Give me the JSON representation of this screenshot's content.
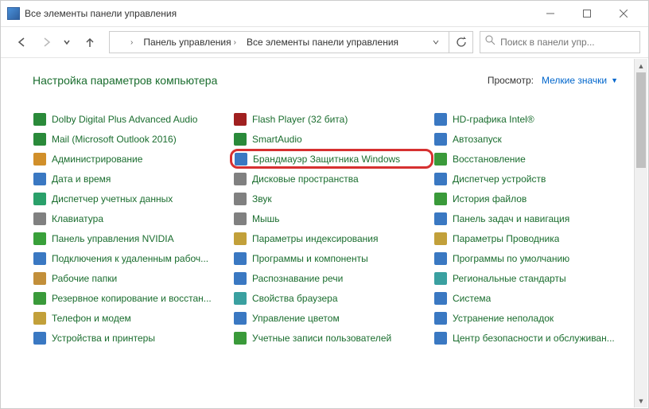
{
  "window": {
    "title": "Все элементы панели управления"
  },
  "toolbar": {
    "seg1": "Панель управления",
    "seg2": "Все элементы панели управления"
  },
  "search": {
    "placeholder": "Поиск в панели упр..."
  },
  "header": {
    "title": "Настройка параметров компьютера",
    "view_label": "Просмотр:",
    "view_value": "Мелкие значки"
  },
  "highlight_key": "c1r2",
  "col0": {
    "r0": "Dolby Digital Plus Advanced Audio",
    "r1": "Mail (Microsoft Outlook 2016)",
    "r2": "Администрирование",
    "r3": "Дата и время",
    "r4": "Диспетчер учетных данных",
    "r5": "Клавиатура",
    "r6": "Панель управления NVIDIA",
    "r7": "Подключения к удаленным рабоч...",
    "r8": "Рабочие папки",
    "r9": "Резервное копирование и восстан...",
    "r10": "Телефон и модем",
    "r11": "Устройства и принтеры"
  },
  "col1": {
    "r0": "Flash Player (32 бита)",
    "r1": "SmartAudio",
    "r2": "Брандмауэр Защитника Windows",
    "r3": "Дисковые пространства",
    "r4": "Звук",
    "r5": "Мышь",
    "r6": "Параметры индексирования",
    "r7": "Программы и компоненты",
    "r8": "Распознавание речи",
    "r9": "Свойства браузера",
    "r10": "Управление цветом",
    "r11": "Учетные записи пользователей"
  },
  "col2": {
    "r0": "HD-графика Intel®",
    "r1": "Автозапуск",
    "r2": "Восстановление",
    "r3": "Диспетчер устройств",
    "r4": "История файлов",
    "r5": "Панель задач и навигация",
    "r6": "Параметры Проводника",
    "r7": "Программы по умолчанию",
    "r8": "Региональные стандарты",
    "r9": "Система",
    "r10": "Устранение неполадок",
    "r11": "Центр безопасности и обслуживан..."
  },
  "icons": {
    "c0r0": "#2a8a3a",
    "c0r1": "#2a8a3a",
    "c0r2": "#d18f2a",
    "c0r3": "#3a78c2",
    "c0r4": "#2aa06a",
    "c0r5": "#808080",
    "c0r6": "#39a03a",
    "c0r7": "#3a78c2",
    "c0r8": "#c28f3a",
    "c0r9": "#3a9a3a",
    "c0r10": "#c2a03a",
    "c0r11": "#3a78c2",
    "c1r0": "#a02020",
    "c1r1": "#2a8a3a",
    "c1r2": "#3a78c2",
    "c1r3": "#808080",
    "c1r4": "#808080",
    "c1r5": "#808080",
    "c1r6": "#c2a03a",
    "c1r7": "#3a78c2",
    "c1r8": "#3a78c2",
    "c1r9": "#3aa0a0",
    "c1r10": "#3a78c2",
    "c1r11": "#3a9a3a",
    "c2r0": "#3a78c2",
    "c2r1": "#3a78c2",
    "c2r2": "#3a9a3a",
    "c2r3": "#3a78c2",
    "c2r4": "#3a9a3a",
    "c2r5": "#3a78c2",
    "c2r6": "#c2a03a",
    "c2r7": "#3a78c2",
    "c2r8": "#3aa0a0",
    "c2r9": "#3a78c2",
    "c2r10": "#3a78c2",
    "c2r11": "#3a78c2"
  }
}
